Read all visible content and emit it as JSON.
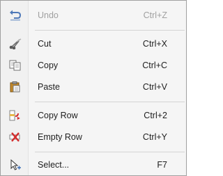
{
  "menu": {
    "items": [
      {
        "label": "Undo",
        "shortcut": "Ctrl+Z",
        "icon": "undo-icon",
        "enabled": false
      },
      {
        "label": "Cut",
        "shortcut": "Ctrl+X",
        "icon": "cut-icon",
        "enabled": true
      },
      {
        "label": "Copy",
        "shortcut": "Ctrl+C",
        "icon": "copy-icon",
        "enabled": true
      },
      {
        "label": "Paste",
        "shortcut": "Ctrl+V",
        "icon": "paste-icon",
        "enabled": true
      },
      {
        "label": "Copy Row",
        "shortcut": "Ctrl+2",
        "icon": "copy-row-icon",
        "enabled": true
      },
      {
        "label": "Empty Row",
        "shortcut": "Ctrl+Y",
        "icon": "empty-row-icon",
        "enabled": true
      },
      {
        "label": "Select...",
        "shortcut": "F7",
        "icon": "select-icon",
        "enabled": true
      }
    ]
  },
  "colors": {
    "menu_background": "#f5f5f5",
    "border": "#a0a0a0",
    "disabled_text": "#a0a0a0",
    "text": "#1e1e1e",
    "icon_blue": "#3b6db5",
    "icon_red": "#d32c2c",
    "icon_yellow": "#e6b84a"
  }
}
